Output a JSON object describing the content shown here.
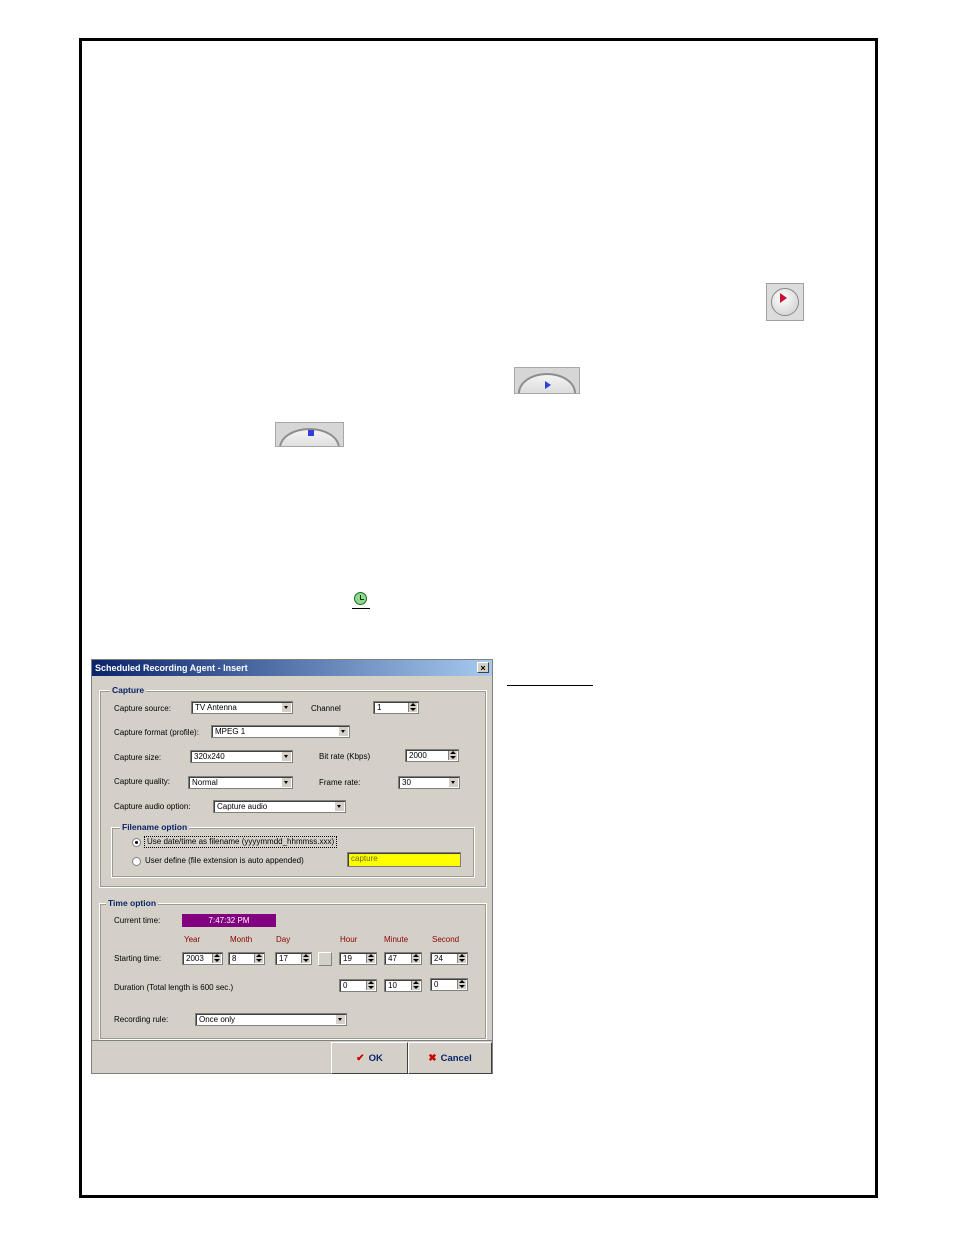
{
  "dialog": {
    "title": "Scheduled Recording Agent - Insert",
    "close_glyph": "×",
    "capture": {
      "group_title": "Capture",
      "source_label": "Capture source:",
      "source_value": "TV Antenna",
      "channel_label": "Channel",
      "channel_value": "1",
      "format_label": "Capture format (profile):",
      "format_value": "MPEG 1",
      "size_label": "Capture size:",
      "size_value": "320x240",
      "bitrate_label": "Bit rate (Kbps)",
      "bitrate_value": "2000",
      "quality_label": "Capture quality:",
      "quality_value": "Normal",
      "framerate_label": "Frame rate:",
      "framerate_value": "30",
      "audio_label": "Capture audio option:",
      "audio_value": "Capture audio",
      "filename": {
        "group_title": "Filename option",
        "option1": "Use date/time as filename (yyyymmdd_hhmmss.xxx)",
        "option2": "User define (file extension is auto appended)",
        "user_value": "capture"
      }
    },
    "time": {
      "group_title": "Time option",
      "current_label": "Current time:",
      "current_value": "7:47:32 PM",
      "col_year": "Year",
      "col_month": "Month",
      "col_day": "Day",
      "col_hour": "Hour",
      "col_minute": "Minute",
      "col_second": "Second",
      "start_label": "Starting time:",
      "year": "2003",
      "month": "8",
      "day": "17",
      "hour": "19",
      "minute": "47",
      "second": "24",
      "duration_label": "Duration (Total length is 600 sec.)",
      "dur_hour": "0",
      "dur_minute": "10",
      "dur_second": "0",
      "rule_label": "Recording rule:",
      "rule_value": "Once only"
    },
    "ok_label": "OK",
    "cancel_label": "Cancel"
  },
  "icons": {
    "record_button": "record-icon",
    "play_button": "play-icon",
    "stop_button": "stop-icon",
    "schedule": "clock-icon"
  },
  "colors": {
    "titlebar": "#0a246a",
    "current_time_bg": "#800080",
    "filename_bg": "#ffff00",
    "column_header": "#8b0000"
  }
}
